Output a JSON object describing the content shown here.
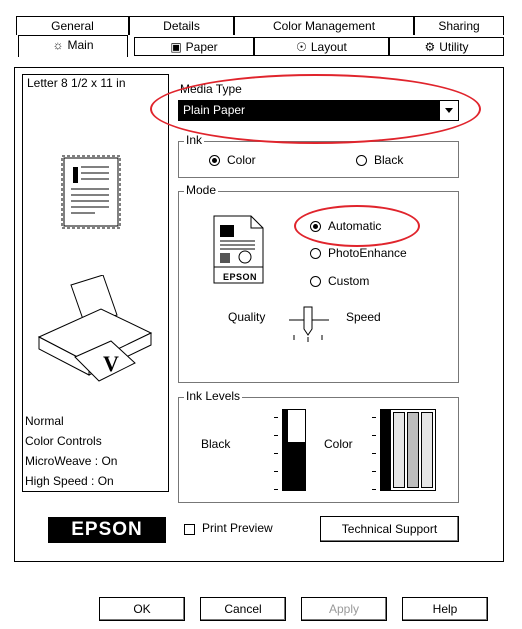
{
  "tabs_back": [
    "General",
    "Details",
    "Color Management",
    "Sharing"
  ],
  "tabs_front": [
    {
      "label": "Main",
      "icon": "main-icon"
    },
    {
      "label": "Paper",
      "icon": "paper-icon"
    },
    {
      "label": "Layout",
      "icon": "layout-icon"
    },
    {
      "label": "Utility",
      "icon": "utility-icon"
    }
  ],
  "paper_size": "Letter 8 1/2 x 11 in",
  "media_type": {
    "label": "Media Type",
    "value": "Plain Paper"
  },
  "ink": {
    "label": "Ink",
    "color": "Color",
    "black": "Black",
    "selected": "Color"
  },
  "mode": {
    "label": "Mode",
    "automatic": "Automatic",
    "photo_enhance": "PhotoEnhance",
    "custom": "Custom",
    "selected": "Automatic",
    "quality": "Quality",
    "speed": "Speed",
    "epson_badge": "EPSON"
  },
  "settings_summary": [
    "Normal",
    "Color Controls",
    "MicroWeave : On",
    "High Speed : On"
  ],
  "ink_levels": {
    "label": "Ink Levels",
    "black": "Black",
    "color": "Color",
    "black_level": 0.6,
    "color_level": 1.0
  },
  "brand_logo": "EPSON",
  "print_preview": {
    "label": "Print Preview",
    "checked": false
  },
  "technical_support": "Technical Support",
  "footer": {
    "ok": "OK",
    "cancel": "Cancel",
    "apply": "Apply",
    "help": "Help"
  },
  "colors": {
    "annotation": "#e0242c"
  }
}
